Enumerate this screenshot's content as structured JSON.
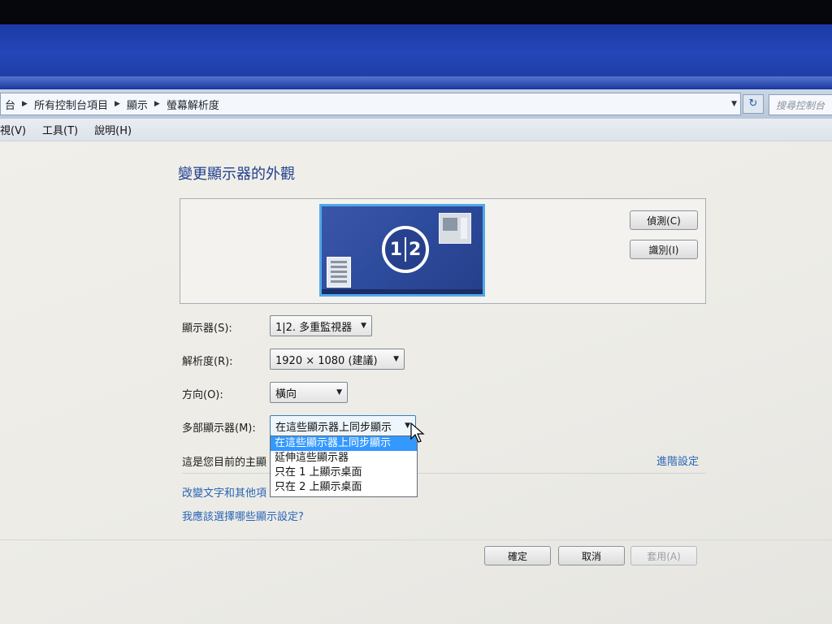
{
  "breadcrumb": {
    "items": [
      "台",
      "所有控制台項目",
      "顯示",
      "螢幕解析度"
    ]
  },
  "search": {
    "placeholder": "搜尋控制台"
  },
  "menu": {
    "items": [
      "視(V)",
      "工具(T)",
      "說明(H)"
    ]
  },
  "page": {
    "title": "變更顯示器的外觀"
  },
  "preview": {
    "monitor_label_left": "1",
    "monitor_label_right": "2",
    "detect_label": "偵測(C)",
    "identify_label": "識別(I)"
  },
  "settings": {
    "display_label": "顯示器(S):",
    "display_value": "1|2. 多重監視器",
    "resolution_label": "解析度(R):",
    "resolution_value": "1920 × 1080 (建議)",
    "orientation_label": "方向(O):",
    "orientation_value": "橫向",
    "multi_label": "多部顯示器(M):",
    "multi_value": "在這些顯示器上同步顯示",
    "multi_options": [
      "在這些顯示器上同步顯示",
      "延伸這些顯示器",
      "只在 1 上顯示桌面",
      "只在 2 上顯示桌面"
    ]
  },
  "info": {
    "primary_text": "這是您目前的主顯",
    "advanced_link": "進階設定",
    "text_size_link": "改變文字和其他項",
    "which_settings_link": "我應該選擇哪些顯示設定?"
  },
  "footer": {
    "ok_label": "確定",
    "cancel_label": "取消",
    "apply_label": "套用(A)"
  },
  "colors": {
    "accent": "#1f3f8f",
    "link": "#2a64b6",
    "selection": "#3399ff",
    "monitor_border": "#4fa9e6"
  }
}
